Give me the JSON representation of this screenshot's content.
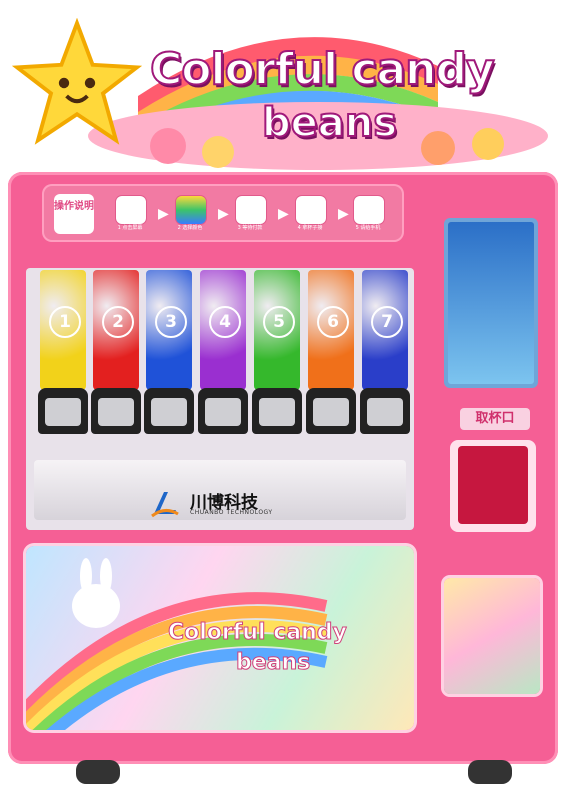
{
  "sign": {
    "title_line_1": "Colorful candy",
    "title_line_2": "beans"
  },
  "steps": {
    "guide_label": "操作说明",
    "items": [
      {
        "label": "1 点击屏幕"
      },
      {
        "label": "2 选择颜色"
      },
      {
        "label": "3 等待付款"
      },
      {
        "label": "4 拿杯子接"
      },
      {
        "label": "5 请给手机"
      }
    ]
  },
  "dispensers": [
    {
      "number": "1",
      "color": "#f2d21a"
    },
    {
      "number": "2",
      "color": "#e3201f"
    },
    {
      "number": "3",
      "color": "#1f52d8"
    },
    {
      "number": "4",
      "color": "#9a2fd0"
    },
    {
      "number": "5",
      "color": "#35b82c"
    },
    {
      "number": "6",
      "color": "#f0701a"
    },
    {
      "number": "7",
      "color": "#2a3ec9"
    }
  ],
  "brand": {
    "name_cn": "川博科技",
    "name_en": "CHUANBO TECHNOLOGY"
  },
  "poster": {
    "line_1": "Colorful candy",
    "line_2": "beans"
  },
  "cup_outlet": {
    "label": "取杯口"
  },
  "colors": {
    "cabinet": "#f55f95",
    "accent": "#d0306c"
  }
}
